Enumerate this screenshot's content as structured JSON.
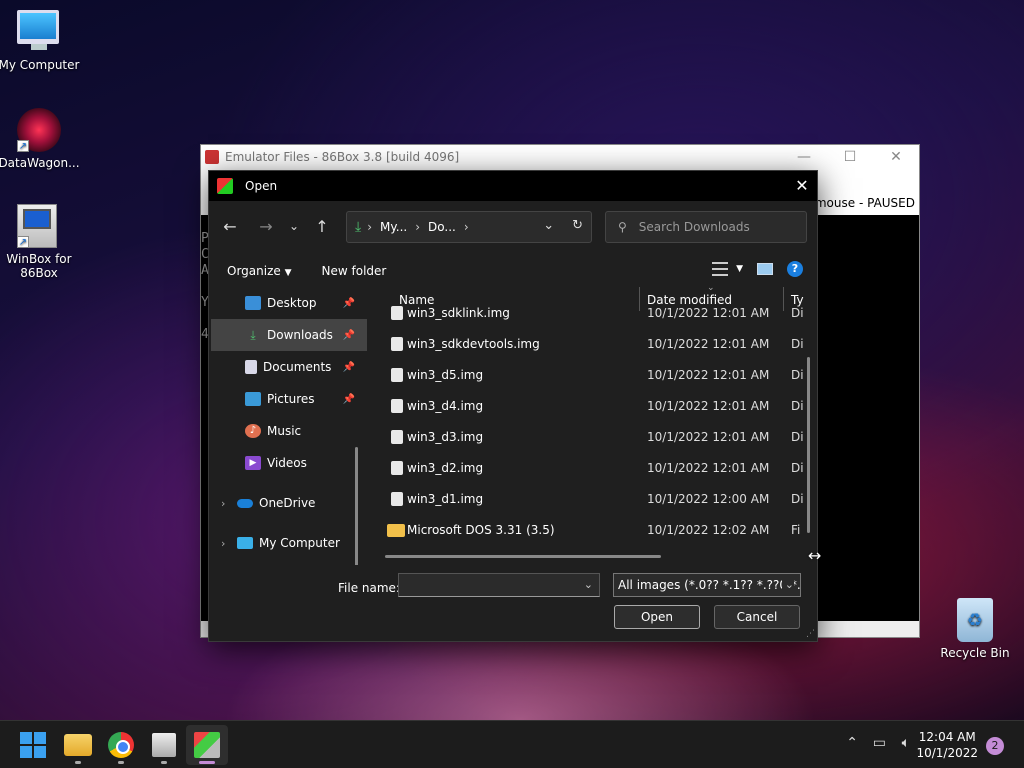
{
  "desktop": {
    "icons": [
      {
        "label": "My Computer"
      },
      {
        "label": "DataWagon..."
      },
      {
        "label": "WinBox for 86Box"
      },
      {
        "label": "Recycle Bin"
      }
    ]
  },
  "emulator_window": {
    "title": "Emulator Files - 86Box 3.8 [build 4096]",
    "status": "re mouse - PAUSED",
    "dos_lines": [
      "P",
      "C",
      "A",
      "",
      "Y",
      "",
      "4"
    ]
  },
  "open_dialog": {
    "title": "Open",
    "breadcrumb": [
      "My...",
      "Do..."
    ],
    "search_placeholder": "Search Downloads",
    "commands": {
      "organize": "Organize",
      "new_folder": "New folder"
    },
    "nav_items": [
      {
        "label": "Desktop",
        "icon": "desktop-icon",
        "pinned": true
      },
      {
        "label": "Downloads",
        "icon": "download-icon",
        "pinned": true,
        "selected": true
      },
      {
        "label": "Documents",
        "icon": "document-icon",
        "pinned": true
      },
      {
        "label": "Pictures",
        "icon": "pictures-icon",
        "pinned": true
      },
      {
        "label": "Music",
        "icon": "music-icon",
        "pinned": false
      },
      {
        "label": "Videos",
        "icon": "videos-icon",
        "pinned": false
      },
      {
        "label": "OneDrive",
        "icon": "cloud-icon",
        "pinned": false
      },
      {
        "label": "My Computer",
        "icon": "computer-icon",
        "pinned": false
      }
    ],
    "columns": {
      "name": "Name",
      "date": "Date modified",
      "type": "Ty"
    },
    "files": [
      {
        "name": "win3_sdklink.img",
        "date": "10/1/2022 12:01 AM",
        "type": "Di"
      },
      {
        "name": "win3_sdkdevtools.img",
        "date": "10/1/2022 12:01 AM",
        "type": "Di"
      },
      {
        "name": "win3_d5.img",
        "date": "10/1/2022 12:01 AM",
        "type": "Di"
      },
      {
        "name": "win3_d4.img",
        "date": "10/1/2022 12:01 AM",
        "type": "Di"
      },
      {
        "name": "win3_d3.img",
        "date": "10/1/2022 12:01 AM",
        "type": "Di"
      },
      {
        "name": "win3_d2.img",
        "date": "10/1/2022 12:01 AM",
        "type": "Di"
      },
      {
        "name": "win3_d1.img",
        "date": "10/1/2022 12:00 AM",
        "type": "Di"
      },
      {
        "name": "Microsoft DOS 3.31 (3.5)",
        "date": "10/1/2022 12:02 AM",
        "type": "Fi",
        "folder": true
      }
    ],
    "file_name_label": "File name:",
    "file_name_value": "",
    "filter": "All images (*.0?? *.1?? *.??0 *.86",
    "open_label": "Open",
    "cancel_label": "Cancel"
  },
  "taskbar": {
    "time": "12:04 AM",
    "date": "10/1/2022",
    "notifications": "2"
  }
}
